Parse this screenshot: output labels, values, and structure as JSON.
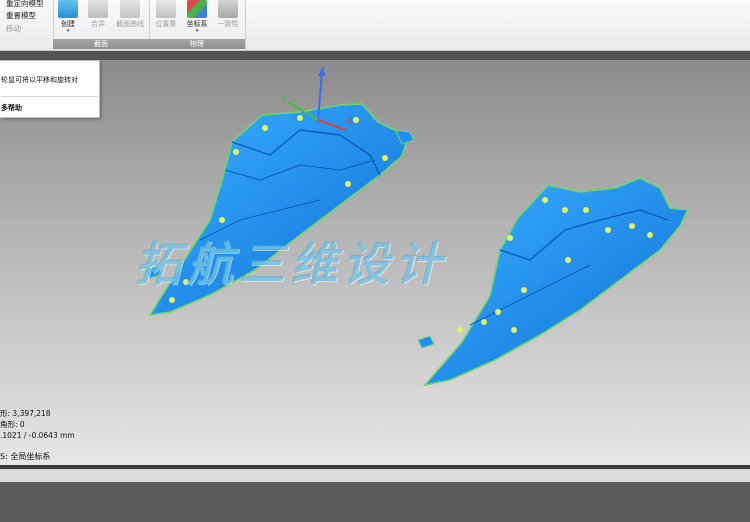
{
  "ribbon": {
    "left_group": {
      "row1": "重定向模型",
      "row2": "重置模型",
      "row3": "移动·"
    },
    "group1": {
      "title": "截面",
      "buttons": [
        {
          "label": "创建",
          "dropdown": "▾",
          "disabled": false
        },
        {
          "label": "合并",
          "disabled": true
        },
        {
          "label": "截面曲线",
          "disabled": true
        }
      ]
    },
    "group2": {
      "title": "物理",
      "buttons": [
        {
          "label": "位置集",
          "disabled": true
        },
        {
          "label": "坐标系",
          "dropdown": "▾",
          "disabled": false
        },
        {
          "label": "一致性",
          "disabled": true
        }
      ]
    }
  },
  "popup": {
    "line1": "轮鼠可将以平移和旋转对",
    "line2": "多帮助"
  },
  "watermark": "拓航三维设计",
  "stats": {
    "line1": "形: 3,397,218",
    "line2": "角形: 0",
    "line3": ".1021 / -0.0643 mm"
  },
  "coord_system": "S: 全局坐标系",
  "axes": {
    "x": "X",
    "y": "Y",
    "z": "Z"
  },
  "colors": {
    "model": "#1e90ff",
    "markers": "#e0f26a",
    "edges": "#7fd36b"
  }
}
